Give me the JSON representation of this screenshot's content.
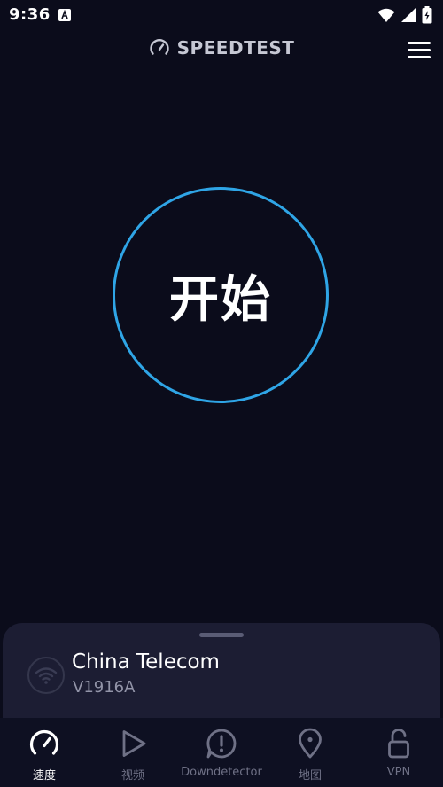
{
  "status_bar": {
    "time": "9:36",
    "app_icon": "a-box-icon",
    "icons": [
      "wifi-icon",
      "signal-icon",
      "battery-icon"
    ]
  },
  "header": {
    "brand": "SPEEDTEST",
    "brand_icon": "gauge-icon",
    "menu_icon": "hamburger-menu-icon"
  },
  "main": {
    "start_label": "开始",
    "ring_color": "#2fa5e6"
  },
  "provider": {
    "name": "China Telecom",
    "device": "V1916A",
    "icon": "wifi-icon"
  },
  "nav": {
    "items": [
      {
        "label": "速度",
        "icon": "speedometer-icon",
        "active": true
      },
      {
        "label": "视频",
        "icon": "play-icon",
        "active": false
      },
      {
        "label": "Downdetector",
        "icon": "alert-icon",
        "active": false
      },
      {
        "label": "地图",
        "icon": "map-pin-icon",
        "active": false
      },
      {
        "label": "VPN",
        "icon": "lock-open-icon",
        "active": false
      }
    ]
  },
  "colors": {
    "background": "#0b0c1b",
    "accent": "#2fa5e6",
    "sheet": "#1c1d33",
    "nav_inactive": "#6f7186"
  }
}
